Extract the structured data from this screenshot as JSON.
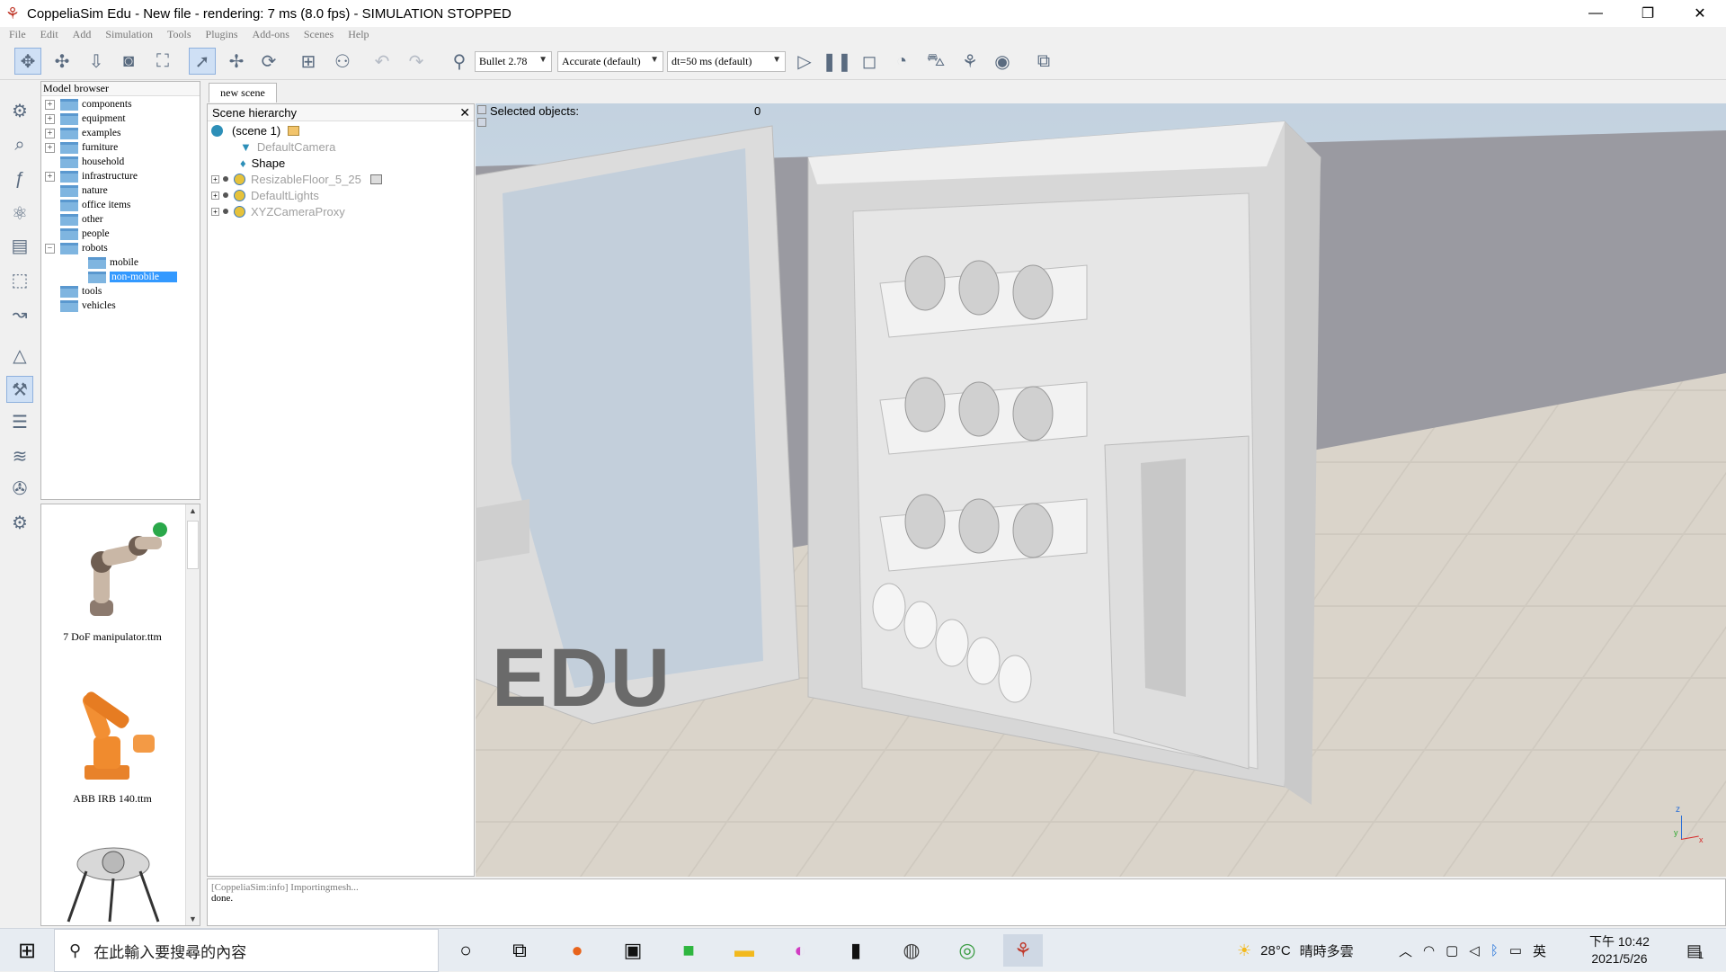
{
  "window": {
    "title": "CoppeliaSim Edu - New file - rendering: 7 ms (8.0 fps) - SIMULATION STOPPED",
    "minimize": "—",
    "restore": "❐",
    "close": "✕"
  },
  "menu": [
    "File",
    "Edit",
    "Add",
    "Simulation",
    "Tools",
    "Plugins",
    "Add-ons",
    "Scenes",
    "Help"
  ],
  "toolbar": {
    "engine": "Bullet 2.78",
    "accuracy": "Accurate (default)",
    "timestep": "dt=50 ms (default)"
  },
  "model_browser": {
    "title": "Model browser",
    "items": [
      {
        "label": "components",
        "expandable": true
      },
      {
        "label": "equipment",
        "expandable": true
      },
      {
        "label": "examples",
        "expandable": true
      },
      {
        "label": "furniture",
        "expandable": true
      },
      {
        "label": "household",
        "expandable": false
      },
      {
        "label": "infrastructure",
        "expandable": true
      },
      {
        "label": "nature",
        "expandable": false
      },
      {
        "label": "office items",
        "expandable": false
      },
      {
        "label": "other",
        "expandable": false
      },
      {
        "label": "people",
        "expandable": false
      },
      {
        "label": "robots",
        "expandable": true,
        "expanded": true
      },
      {
        "label": "mobile",
        "child": true
      },
      {
        "label": "non-mobile",
        "child": true,
        "selected": true
      },
      {
        "label": "tools",
        "expandable": false
      },
      {
        "label": "vehicles",
        "expandable": false
      }
    ]
  },
  "thumbnails": [
    {
      "label": "7 DoF manipulator.ttm"
    },
    {
      "label": "ABB IRB 140.ttm"
    }
  ],
  "scene_tab": "new scene",
  "hierarchy": {
    "title": "Scene hierarchy",
    "close": "✕",
    "items": [
      {
        "label": "(scene 1)",
        "dim": false
      },
      {
        "label": "DefaultCamera",
        "dim": true
      },
      {
        "label": "Shape",
        "dim": false
      },
      {
        "label": "ResizableFloor_5_25",
        "dim": true
      },
      {
        "label": "DefaultLights",
        "dim": true
      },
      {
        "label": "XYZCameraProxy",
        "dim": true
      }
    ]
  },
  "viewport": {
    "selected_label": "Selected objects:",
    "selected_count": "0",
    "watermark": "EDU",
    "axis_z": "z",
    "axis_y": "y",
    "axis_x": "x"
  },
  "console": {
    "line1": "[CoppeliaSim:info] Importingmesh...",
    "line2": "done."
  },
  "taskbar": {
    "search_placeholder": "在此輸入要搜尋的內容",
    "weather_temp": "28°C",
    "weather_desc": "晴時多雲",
    "ime": "英",
    "time": "下午 10:42",
    "date": "2021/5/26",
    "notification_count": "1"
  },
  "colors": {
    "accent": "#3399ff",
    "toolbar_icon": "#5a6b80",
    "cabinet": "#e4e4e4"
  }
}
